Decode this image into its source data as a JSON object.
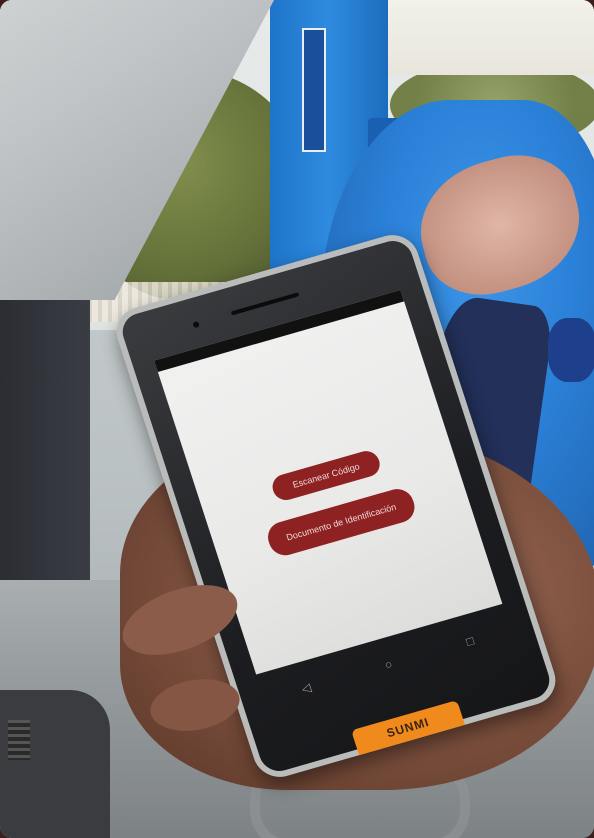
{
  "scene": {
    "description_colors": {
      "attendant_shirt": "#2a7fd6",
      "button": "#8e2222",
      "brand_strip": "#f08a1c"
    }
  },
  "phone": {
    "status_bar": {
      "time": ""
    },
    "screen": {
      "buttons": [
        {
          "label": "Escanear Código"
        },
        {
          "label": "Documento de Identificación"
        }
      ]
    },
    "nav": {
      "back_icon": "triangle-back-icon",
      "home_icon": "circle-home-icon",
      "recents_icon": "square-recents-icon"
    },
    "brand": "SUNMI"
  }
}
